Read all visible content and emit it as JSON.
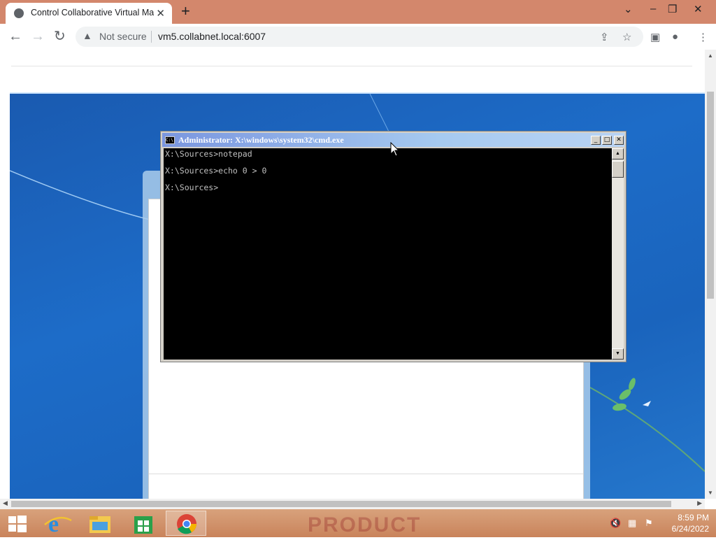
{
  "browser": {
    "tab_title": "Control Collaborative Virtual Mac",
    "new_tab_label": "+",
    "security_label": "Not secure",
    "url": "vm5.collabnet.local:6007"
  },
  "cmd_window": {
    "title": "Administrator: X:\\windows\\system32\\cmd.exe",
    "lines": [
      "X:\\Sources>notepad",
      "X:\\Sources>echo 0 > 0",
      "X:\\Sources>"
    ]
  },
  "taskbar": {
    "apps": [
      "start-icon",
      "internet-explorer-icon",
      "file-explorer-icon",
      "store-icon",
      "chrome-icon"
    ],
    "watermark": "PRODUCT",
    "clock": {
      "time": "8:59 PM",
      "date": "6/24/2022"
    }
  },
  "colors": {
    "tabbar": "#d3876c",
    "desktop": "#1d6cc8",
    "taskbar": "#c9835b",
    "console": "#000000"
  }
}
